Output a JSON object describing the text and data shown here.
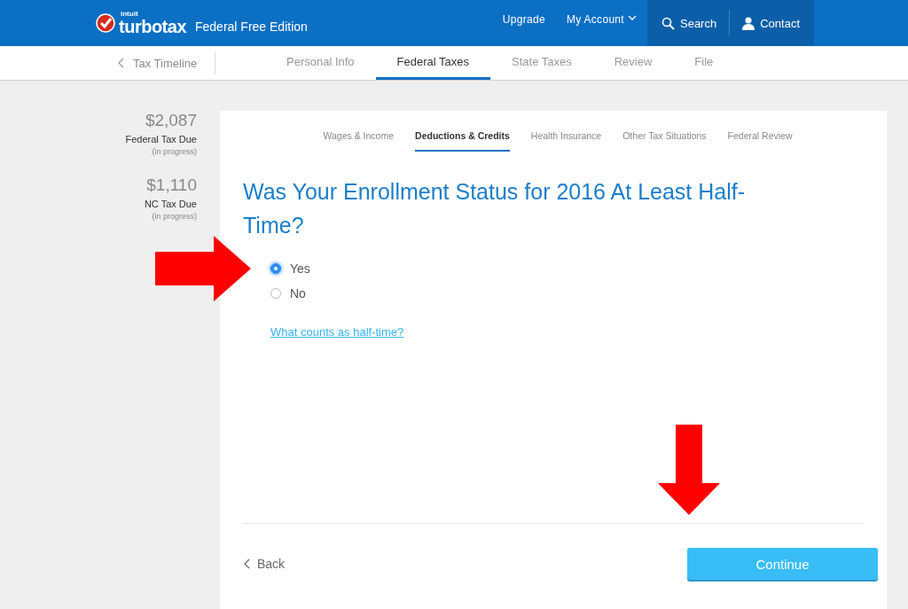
{
  "header": {
    "brand_small": "intuit",
    "brand": "turbotax",
    "edition": "Federal Free Edition",
    "nav": [
      {
        "label": "Upgrade",
        "kind": "link"
      },
      {
        "label": "My Account",
        "kind": "menu"
      },
      {
        "label": "Search",
        "kind": "search"
      },
      {
        "label": "Contact",
        "kind": "contact"
      }
    ]
  },
  "subnav": {
    "back": "Tax Timeline",
    "tabs": [
      {
        "label": "Personal Info",
        "selected": false
      },
      {
        "label": "Federal Taxes",
        "selected": true
      },
      {
        "label": "State Taxes",
        "selected": false
      },
      {
        "label": "Review",
        "selected": false
      },
      {
        "label": "File",
        "selected": false
      }
    ]
  },
  "summary": [
    {
      "amount": "$2,087",
      "label": "Federal Tax Due",
      "note": "(in progress)"
    },
    {
      "amount": "$1,110",
      "label": "NC Tax Due",
      "note": "(in progress)"
    }
  ],
  "card": {
    "tabs": [
      {
        "label": "Wages & Income",
        "selected": false
      },
      {
        "label": "Deductions & Credits",
        "selected": true
      },
      {
        "label": "Health Insurance",
        "selected": false
      },
      {
        "label": "Other Tax Situations",
        "selected": false
      },
      {
        "label": "Federal Review",
        "selected": false
      }
    ],
    "question": "Was Your Enrollment Status for 2016 At Least Half-Time?",
    "options": [
      {
        "label": "Yes",
        "selected": true
      },
      {
        "label": "No",
        "selected": false
      }
    ],
    "help_link": "What counts as half-time?",
    "back": "Back",
    "continue": "Continue"
  }
}
